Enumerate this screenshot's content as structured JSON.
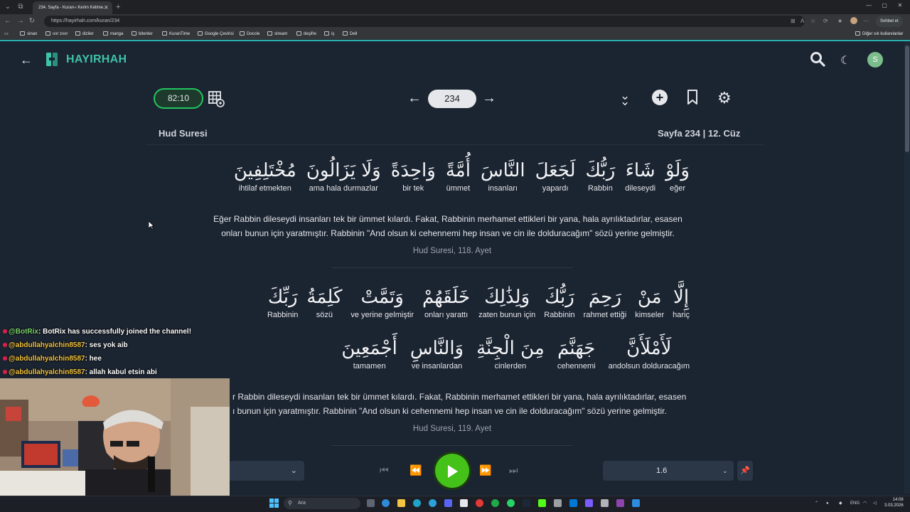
{
  "browser": {
    "tab_title": "234. Sayfa - Kuran-ı Kerim Kelime...",
    "url": "https://hayirhah.com/kuran/234",
    "chat_button": "Sohbet et",
    "bookmarks": [
      "sinan",
      "ıvır zıvır",
      "diziler",
      "manga",
      "bitenler",
      "KuranTime",
      "Google Çevirisi",
      "Doccle",
      "stream",
      "deşifre",
      "iş",
      "Dell"
    ],
    "other_bookmarks": "Diğer sık kullanılanlar"
  },
  "app": {
    "brand": "HAYIRHAH",
    "avatar_letter": "S",
    "timer": "82:10",
    "page_number": "234",
    "surah": "Hud Suresi",
    "page_info": "Sayfa 234 | 12. Cüz",
    "accent_color": "#3ec2a9"
  },
  "verses": [
    {
      "line1": [
        {
          "ar": "وَلَوْ",
          "tr": "eğer"
        },
        {
          "ar": "شَاءَ",
          "tr": "dileseydi"
        },
        {
          "ar": "رَبُّكَ",
          "tr": "Rabbin"
        },
        {
          "ar": "لَجَعَلَ",
          "tr": "yapardı"
        },
        {
          "ar": "النَّاسَ",
          "tr": "insanları"
        },
        {
          "ar": "أُمَّةً",
          "tr": "ümmet"
        },
        {
          "ar": "وَاحِدَةً",
          "tr": "bir tek"
        },
        {
          "ar": "وَلَا يَزَالُونَ",
          "tr": "ama hala durmazlar"
        },
        {
          "ar": "مُخْتَلِفِينَ",
          "tr": "ihtilaf etmekten"
        }
      ],
      "meaning": "Eğer Rabbin dileseydi insanları tek bir ümmet kılardı. Fakat, Rabbinin merhamet ettikleri bir yana, hala ayrılıktadırlar, esasen onları bunun için yaratmıştır. Rabbinin \"And olsun ki cehennemi hep insan ve cin ile dolduracağım\" sözü yerine gelmiştir.",
      "ref": "Hud Suresi, 118. Ayet"
    },
    {
      "line1": [
        {
          "ar": "إِلَّا",
          "tr": "hariç"
        },
        {
          "ar": "مَنْ",
          "tr": "kimseler"
        },
        {
          "ar": "رَحِمَ",
          "tr": "rahmet ettiği"
        },
        {
          "ar": "رَبُّكَ",
          "tr": "Rabbinin"
        },
        {
          "ar": "وَلِذَٰلِكَ",
          "tr": "zaten bunun için"
        },
        {
          "ar": "خَلَقَهُمْ",
          "tr": "onları yarattı"
        },
        {
          "ar": "وَتَمَّتْ",
          "tr": "ve yerine gelmiştir"
        },
        {
          "ar": "كَلِمَةُ",
          "tr": "sözü"
        },
        {
          "ar": "رَبِّكَ",
          "tr": "Rabbinin"
        }
      ],
      "line2": [
        {
          "ar": "لَأَمْلَأَنَّ",
          "tr": "andolsun dolduracağım"
        },
        {
          "ar": "جَهَنَّمَ",
          "tr": "cehennemi"
        },
        {
          "ar": "مِنَ الْجِنَّةِ",
          "tr": "cinlerden"
        },
        {
          "ar": "وَالنَّاسِ",
          "tr": "ve insanlardan"
        },
        {
          "ar": "أَجْمَعِينَ",
          "tr": "tamamen"
        }
      ],
      "meaning_l1": "r Rabbin dileseydi insanları tek bir ümmet kılardı. Fakat, Rabbinin merhamet ettikleri bir yana, hala ayrılıktadırlar, esasen",
      "meaning_l2": "ı bunun için yaratmıştır. Rabbinin \"And olsun ki cehennemi hep insan ve cin ile dolduracağım\" sözü yerine gelmiştir.",
      "ref": "Hud Suresi, 119. Ayet"
    }
  ],
  "player": {
    "speed": "1.6",
    "accent": "#44c21a"
  },
  "chat": [
    {
      "user": "@BotRix",
      "msg": ": BotRix has successfully joined the channel!"
    },
    {
      "user": "@abdullahyalchin8587",
      "msg": ": ses yok aib"
    },
    {
      "user": "@abdullahyalchin8587",
      "msg": ": hee"
    },
    {
      "user": "@abdullahyalchin8587",
      "msg": ": allah kabul etsin abi"
    }
  ],
  "taskbar": {
    "search_placeholder": "Ara",
    "lang": "ENG",
    "time": "14:08",
    "date": "3.03.2026"
  }
}
